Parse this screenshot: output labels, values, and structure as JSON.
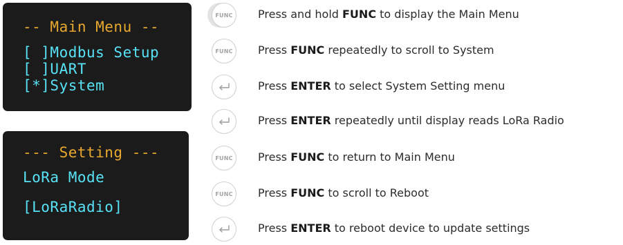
{
  "screens": [
    {
      "header": "-- Main Menu --",
      "lines": [
        "[ ]Modbus Setup",
        "[ ]UART",
        "[*]System"
      ]
    },
    {
      "header": "--- Setting ---",
      "lines": [
        "LoRa Mode",
        "[LoRaRadio]"
      ]
    }
  ],
  "button_labels": {
    "func": "FUNC"
  },
  "steps": [
    {
      "button": "func",
      "pre": "Press and hold ",
      "key": "FUNC",
      "post": " to display the Main Menu"
    },
    {
      "button": "func",
      "pre": "Press ",
      "key": "FUNC",
      "post": " repeatedly to scroll to System"
    },
    {
      "button": "enter",
      "pre": "Press ",
      "key": "ENTER",
      "post": " to select System Setting menu"
    },
    {
      "button": "enter",
      "pre": "Press ",
      "key": "ENTER",
      "post": " repeatedly until display reads LoRa Radio"
    },
    {
      "button": "func",
      "pre": "Press ",
      "key": "FUNC",
      "post": " to return to Main Menu"
    },
    {
      "button": "func",
      "pre": "Press ",
      "key": "FUNC",
      "post": " to scroll to Reboot"
    },
    {
      "button": "enter",
      "pre": "Press ",
      "key": "ENTER",
      "post": " to reboot device to update settings"
    }
  ],
  "icons": {
    "enter": "enter-arrow-icon"
  },
  "colors": {
    "lcd_background": "#1b1b1b",
    "lcd_header": "#e8a92e",
    "lcd_text": "#58e2f6"
  }
}
